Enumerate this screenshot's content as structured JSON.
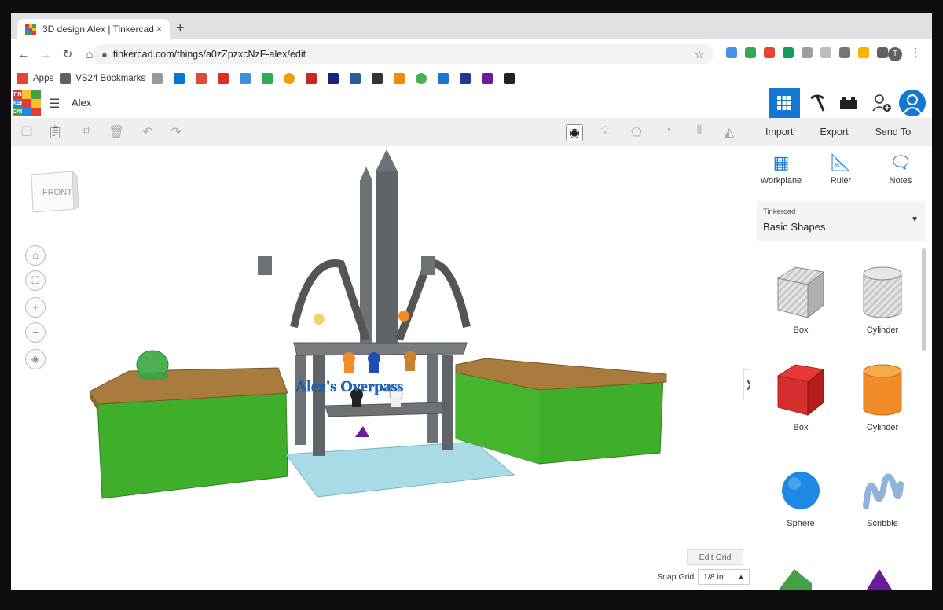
{
  "browser": {
    "tab_title": "3D design Alex | Tinkercad",
    "tab_close": "×",
    "new_tab": "+",
    "url": "tinkercad.com/things/a0zZpzxcNzF-alex/edit",
    "bookmarks": [
      {
        "label": "Apps",
        "color": "#4285f4"
      },
      {
        "label": "VS24 Bookmarks",
        "color": "#5f6368"
      },
      {
        "label": "",
        "color": "#999999"
      },
      {
        "label": "",
        "color": "#0078d4"
      },
      {
        "label": "",
        "color": "#dd4b39"
      },
      {
        "label": "",
        "color": "#d93025"
      },
      {
        "label": "",
        "color": "#3d8fd6"
      },
      {
        "label": "",
        "color": "#34a853"
      },
      {
        "label": "",
        "color": "#e8a100"
      },
      {
        "label": "",
        "color": "#c62828"
      },
      {
        "label": "",
        "color": "#1a237e"
      },
      {
        "label": "",
        "color": "#2c5aa0"
      },
      {
        "label": "",
        "color": "#333333"
      },
      {
        "label": "",
        "color": "#f28b00"
      },
      {
        "label": "",
        "color": "#4caf50"
      },
      {
        "label": "",
        "color": "#1976d2"
      },
      {
        "label": "",
        "color": "#283593"
      },
      {
        "label": "",
        "color": "#6a1b9a"
      },
      {
        "label": "",
        "color": "#222222"
      }
    ],
    "profile_initial": "T"
  },
  "app": {
    "logo_letters": [
      "TIN",
      "KER",
      "CAD"
    ],
    "design_name": "Alex"
  },
  "toolbar": {
    "import_label": "Import",
    "export_label": "Export",
    "send_label": "Send To"
  },
  "workplane": {
    "viewcube_label": "FRONT",
    "text_object": "Alex's Overpass",
    "edit_grid": "Edit Grid",
    "snap_grid_label": "Snap Grid",
    "snap_grid_value": "1/8 in",
    "colors": {
      "green": "#3fae2a",
      "brown": "#a97b3c",
      "tower": "#6d7277",
      "water": "#a9dbe6",
      "text": "#1c6dc9"
    }
  },
  "panel": {
    "workplane_label": "Workplane",
    "ruler_label": "Ruler",
    "notes_label": "Notes",
    "library_category": "Tinkercad",
    "library_name": "Basic Shapes",
    "shapes": [
      {
        "label": "Box"
      },
      {
        "label": "Cylinder"
      },
      {
        "label": "Box"
      },
      {
        "label": "Cylinder"
      },
      {
        "label": "Sphere"
      },
      {
        "label": "Scribble"
      }
    ]
  }
}
